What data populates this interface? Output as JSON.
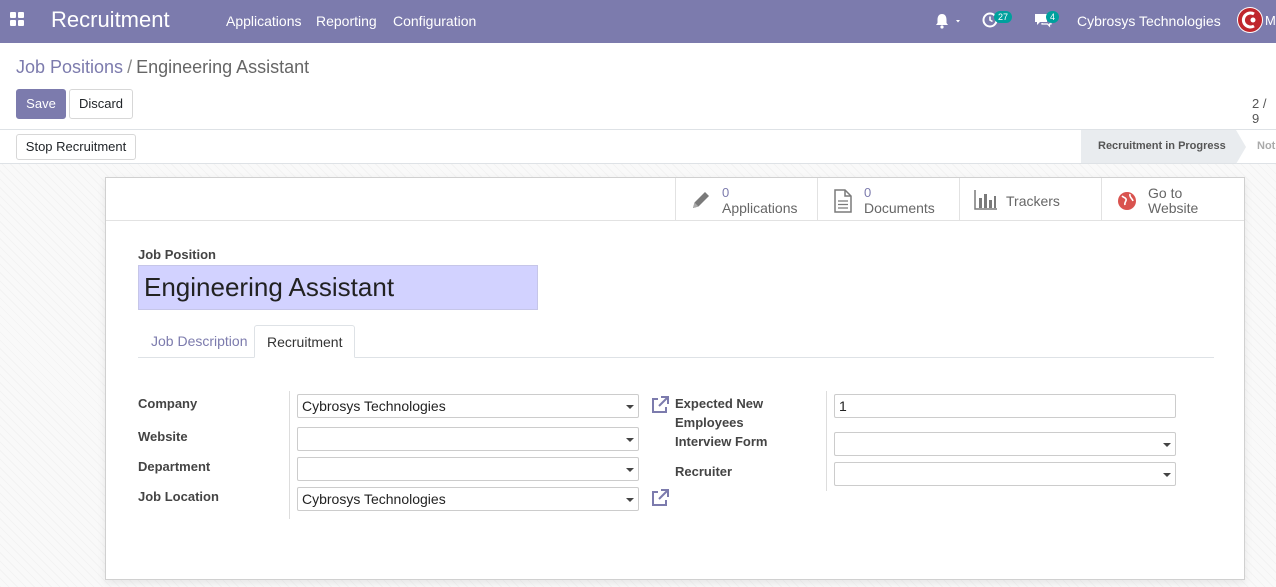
{
  "navbar": {
    "app_title": "Recruitment",
    "menu": [
      "Applications",
      "Reporting",
      "Configuration"
    ],
    "activity_count": "27",
    "message_count": "4",
    "company": "Cybrosys Technologies",
    "user_initial": "M",
    "background_color": "#7c7bad"
  },
  "breadcrumb": {
    "parent": "Job Positions",
    "separator": "/",
    "current": "Engineering Assistant"
  },
  "buttons": {
    "save": "Save",
    "discard": "Discard",
    "stop_recruitment": "Stop Recruitment"
  },
  "pager": "2 / 9",
  "statusbar": {
    "active_stage": "Recruitment in Progress",
    "next_stage": "Not"
  },
  "smart_buttons": {
    "applications": {
      "count": "0",
      "label": "Applications",
      "icon": "pencil-icon"
    },
    "documents": {
      "count": "0",
      "label": "Documents",
      "icon": "document-icon"
    },
    "trackers": {
      "label": "Trackers",
      "icon": "bar-chart-icon"
    },
    "website": {
      "label_line1": "Go to",
      "label_line2": "Website",
      "icon": "globe-icon"
    }
  },
  "form": {
    "job_position_label": "Job Position",
    "job_position_value": "Engineering Assistant",
    "tabs": [
      "Job Description",
      "Recruitment"
    ],
    "active_tab": "Recruitment",
    "left_fields": {
      "company_label": "Company",
      "company_value": "Cybrosys Technologies",
      "website_label": "Website",
      "website_value": "",
      "department_label": "Department",
      "department_value": "",
      "job_location_label": "Job Location",
      "job_location_value": "Cybrosys Technologies"
    },
    "right_fields": {
      "expected_label_line1": "Expected New",
      "expected_label_line2": "Employees",
      "expected_value": "1",
      "interview_form_label": "Interview Form",
      "interview_form_value": "",
      "recruiter_label": "Recruiter",
      "recruiter_value": ""
    }
  }
}
